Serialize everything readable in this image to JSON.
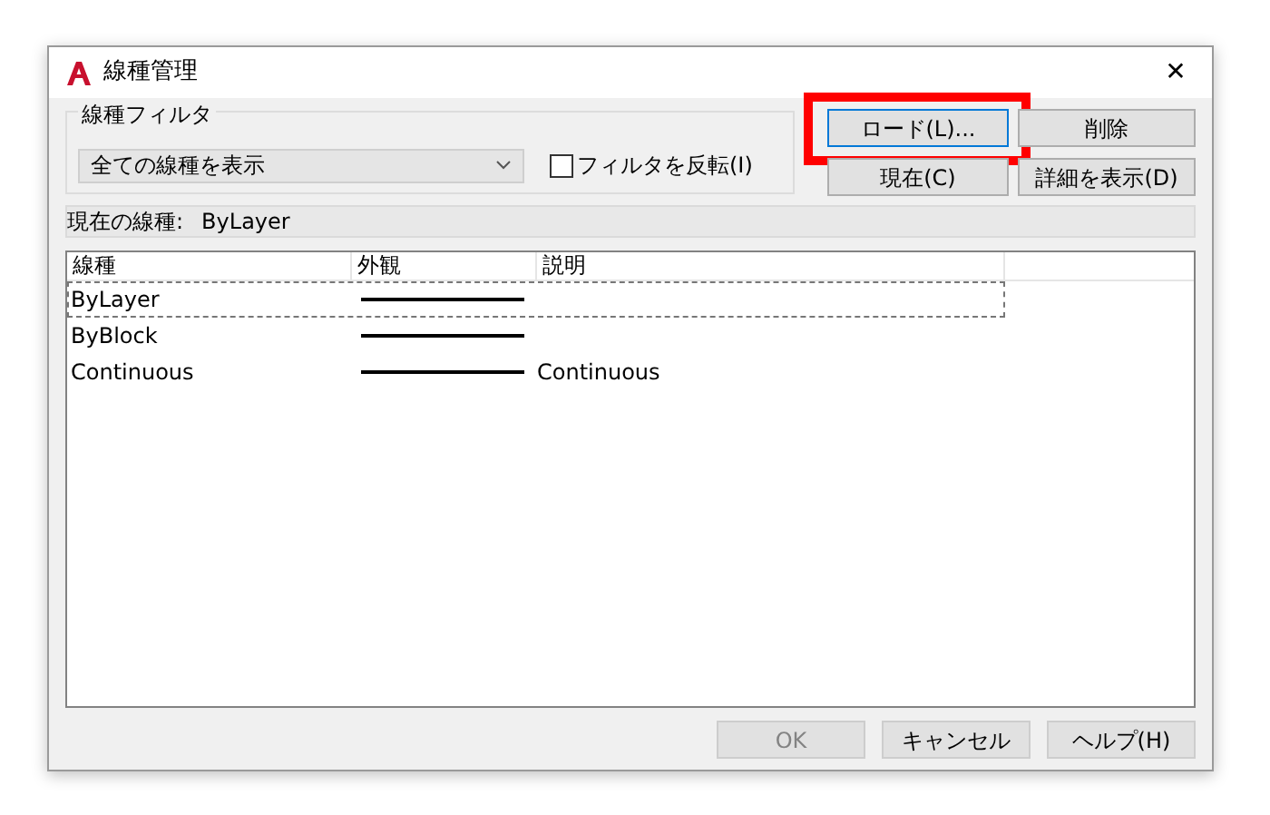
{
  "window": {
    "title": "線種管理",
    "close": "✕"
  },
  "filter": {
    "label": "線種フィルタ",
    "value": "全ての線種を表示",
    "invert": {
      "label": "フィルタを反転(I)",
      "checked": false
    }
  },
  "buttons": [
    {
      "label": "ロード(L)...",
      "highlighted": true,
      "focused": true
    },
    {
      "label": "削除",
      "highlighted": false,
      "focused": false
    },
    {
      "label": "現在(C)",
      "highlighted": false,
      "focused": false
    },
    {
      "label": "詳細を表示(D)",
      "highlighted": false,
      "focused": false
    }
  ],
  "current": {
    "label": "現在の線種:",
    "value": "ByLayer"
  },
  "table": {
    "columns": [
      "線種",
      "外観",
      "説明"
    ],
    "rows": [
      {
        "name": "ByLayer",
        "description": "",
        "selected": true
      },
      {
        "name": "ByBlock",
        "description": "",
        "selected": false
      },
      {
        "name": "Continuous",
        "description": "Continuous",
        "selected": false
      }
    ]
  },
  "footer": [
    {
      "label": "OK",
      "disabled": true
    },
    {
      "label": "キャンセル",
      "disabled": false
    },
    {
      "label": "ヘルプ(H)",
      "disabled": false
    }
  ]
}
